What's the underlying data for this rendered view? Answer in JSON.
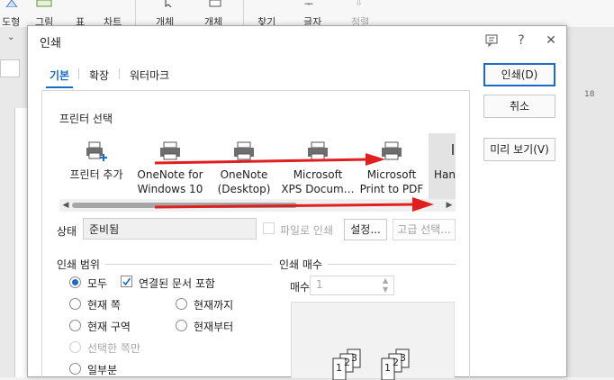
{
  "ribbon": {
    "items": [
      "도형",
      "그림",
      "표",
      "차트",
      "개체",
      "개체",
      "찾기",
      "글자",
      "정렬"
    ],
    "ruler_mark": "18"
  },
  "dialog": {
    "title": "인쇄",
    "help": "?",
    "tabs": [
      "기본",
      "확장",
      "워터마크"
    ],
    "printer_section": "프린터 선택",
    "printers": [
      {
        "line1": "프린터 추가",
        "line2": ""
      },
      {
        "line1": "OneNote for",
        "line2": "Windows 10"
      },
      {
        "line1": "OneNote",
        "line2": "(Desktop)"
      },
      {
        "line1": "Microsoft",
        "line2": "XPS Docum…"
      },
      {
        "line1": "Microsoft",
        "line2": "Print to PDF"
      },
      {
        "line1": "Hand",
        "line2": ""
      }
    ],
    "status_label": "상태",
    "status_value": "준비됨",
    "save_to_file": "파일로 인쇄",
    "settings_button": "설정...",
    "advanced_button": "고급 선택...",
    "range_section": "인쇄 범위",
    "range_options": {
      "all": "모두",
      "linked_docs": "연결된 문서 포함",
      "current_page": "현재 쪽",
      "until_current": "현재까지",
      "current_section": "현재 구역",
      "from_current": "현재부터",
      "selected_only": "선택한 쪽만",
      "partial": "일부분"
    },
    "copies_section": "인쇄 매수",
    "copies_label": "매수",
    "copies_value": "1",
    "print_button": "인쇄(D)",
    "cancel_button": "취소",
    "preview_button": "미리 보기(V)",
    "collate_glyphs": [
      "1",
      "2",
      "3",
      "1",
      "2",
      "3"
    ]
  },
  "annotations": {
    "arrow_color": "#e02020"
  }
}
